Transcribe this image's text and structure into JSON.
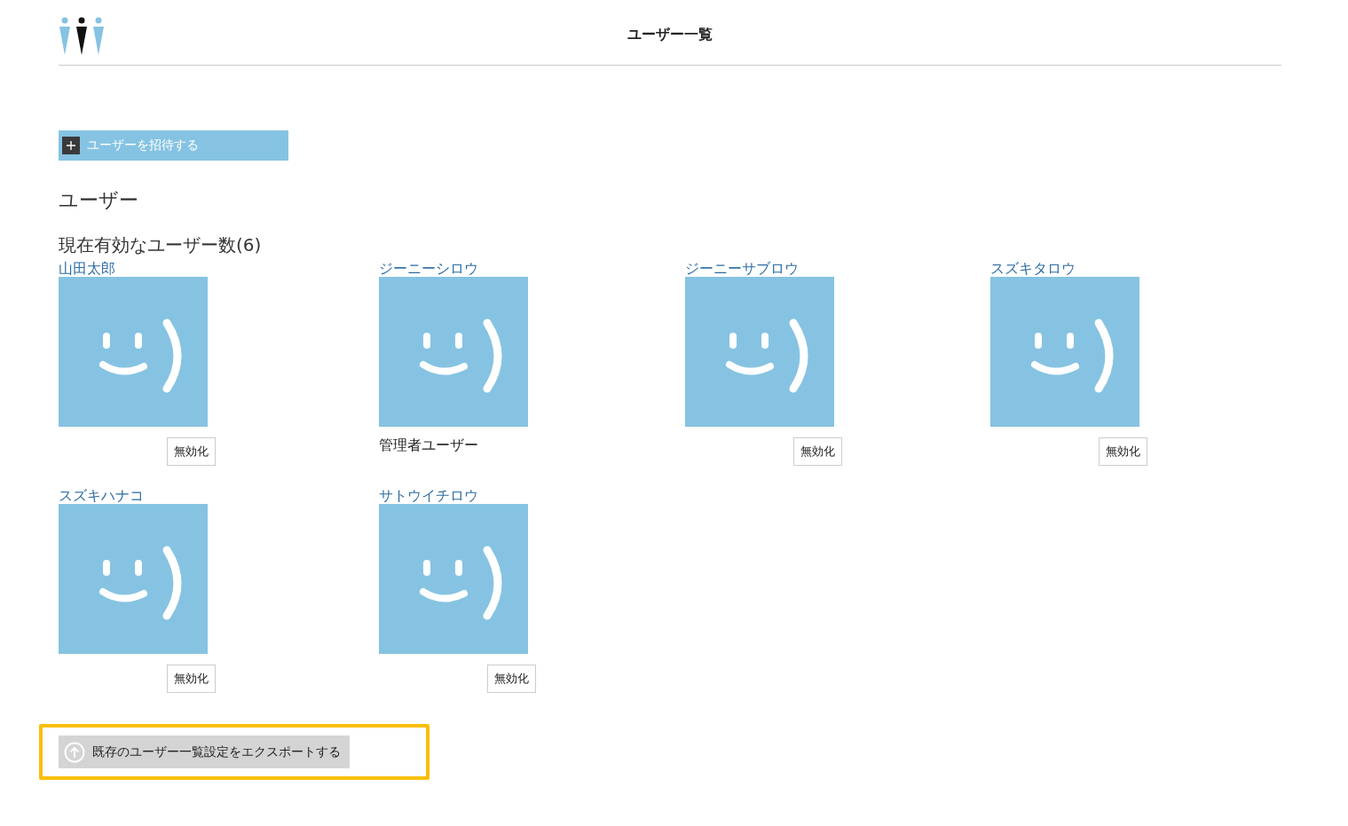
{
  "header": {
    "title": "ユーザー一覧"
  },
  "invite_button": {
    "label": "ユーザーを招待する"
  },
  "section_title": "ユーザー",
  "active_count": "現在有効なユーザー数(6)",
  "users": [
    {
      "name": "山田太郎",
      "kind": "disable",
      "action": "無効化"
    },
    {
      "name": "ジーニーシロウ",
      "kind": "admin",
      "action": "管理者ユーザー"
    },
    {
      "name": "ジーニーサブロウ",
      "kind": "disable",
      "action": "無効化"
    },
    {
      "name": "スズキタロウ",
      "kind": "disable",
      "action": "無効化"
    },
    {
      "name": "スズキハナコ",
      "kind": "disable",
      "action": "無効化"
    },
    {
      "name": "サトウイチロウ",
      "kind": "disable",
      "action": "無効化"
    }
  ],
  "export_button": {
    "label": "既存のユーザー一覧設定をエクスポートする",
    "highlighted": true
  }
}
